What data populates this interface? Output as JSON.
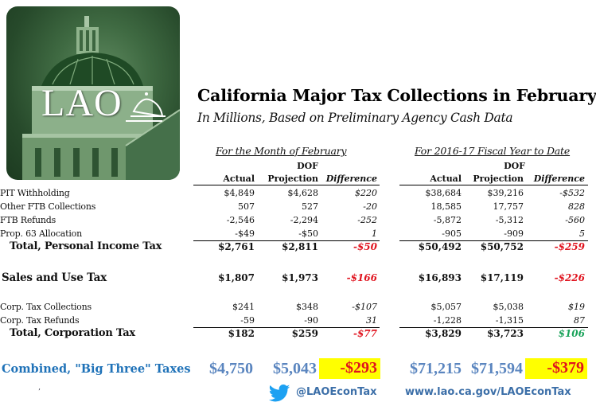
{
  "logo": {
    "text": "LAO",
    "icon": "capitol-dome-icon"
  },
  "title": "California Major Tax Collections in February",
  "subtitle": "In Millions, Based on Preliminary Agency Cash Data",
  "sections": {
    "month": {
      "heading": "For the Month of February",
      "columns": {
        "dof": "DOF",
        "actual": "Actual",
        "projection": "Projection",
        "difference": "Difference"
      }
    },
    "fytd": {
      "heading": "For 2016-17 Fiscal Year to Date",
      "columns": {
        "dof": "DOF",
        "actual": "Actual",
        "projection": "Projection",
        "difference": "Difference"
      }
    }
  },
  "rows": [
    {
      "label": "PIT Withholding",
      "m_actual": "$4,849",
      "m_proj": "$4,628",
      "m_diff": "$220",
      "y_actual": "$38,684",
      "y_proj": "$39,216",
      "y_diff": "-$532"
    },
    {
      "label": "Other FTB Collections",
      "m_actual": "507",
      "m_proj": "527",
      "m_diff": "-20",
      "y_actual": "18,585",
      "y_proj": "17,757",
      "y_diff": "828"
    },
    {
      "label": "FTB Refunds",
      "m_actual": "-2,546",
      "m_proj": "-2,294",
      "m_diff": "-252",
      "y_actual": "-5,872",
      "y_proj": "-5,312",
      "y_diff": "-560"
    },
    {
      "label": "Prop. 63 Allocation",
      "m_actual": "-$49",
      "m_proj": "-$50",
      "m_diff": "1",
      "y_actual": "-905",
      "y_proj": "-909",
      "y_diff": "5"
    },
    {
      "label": "Total, Personal Income Tax",
      "m_actual": "$2,761",
      "m_proj": "$2,811",
      "m_diff": "-$50",
      "y_actual": "$50,492",
      "y_proj": "$50,752",
      "y_diff": "-$259"
    },
    {
      "label": "Sales and Use Tax",
      "m_actual": "$1,807",
      "m_proj": "$1,973",
      "m_diff": "-$166",
      "y_actual": "$16,893",
      "y_proj": "$17,119",
      "y_diff": "-$226"
    },
    {
      "label": "Corp. Tax Collections",
      "m_actual": "$241",
      "m_proj": "$348",
      "m_diff": "-$107",
      "y_actual": "$5,057",
      "y_proj": "$5,038",
      "y_diff": "$19"
    },
    {
      "label": "Corp. Tax Refunds",
      "m_actual": "-59",
      "m_proj": "-90",
      "m_diff": "31",
      "y_actual": "-1,228",
      "y_proj": "-1,315",
      "y_diff": "87"
    },
    {
      "label": "Total, Corporation Tax",
      "m_actual": "$182",
      "m_proj": "$259",
      "m_diff": "-$77",
      "y_actual": "$3,829",
      "y_proj": "$3,723",
      "y_diff": "$106"
    }
  ],
  "combined": {
    "label": "Combined, \"Big Three\" Taxes",
    "m_actual": "$4,750",
    "m_proj": "$5,043",
    "m_diff": "-$293",
    "y_actual": "$71,215",
    "y_proj": "$71,594",
    "y_diff": "-$379"
  },
  "footer": {
    "twitter_icon": "twitter-bird-icon",
    "twitter_handle": "@LAOEconTax",
    "website": "www.lao.ca.gov/LAOEconTax",
    "stray_mark": "’"
  },
  "colors": {
    "negative": "#e0131e",
    "positive": "#1aa35a",
    "combined_text": "#1f72b8",
    "combined_numbers": "#5a85bf",
    "highlight": "#ffff00",
    "footer": "#3c6fa8",
    "twitter": "#1da1f2",
    "logo_green": "#3f6a42"
  }
}
